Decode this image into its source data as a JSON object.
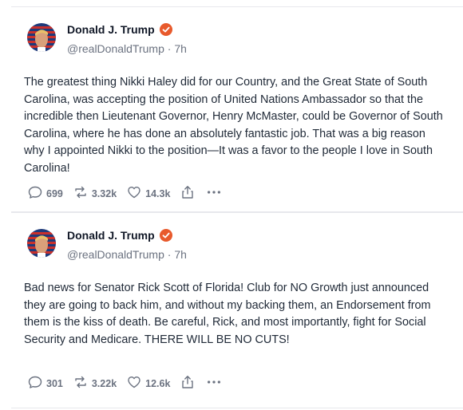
{
  "posts": [
    {
      "author_name": "Donald J. Trump",
      "handle": "@realDonaldTrump",
      "time": "7h",
      "body": "The greatest thing Nikki Haley did for our Country, and the Great State of South Carolina, was accepting the position of United Nations Ambassador so that the incredible then Lieutenant Governor, Henry McMaster, could be Governor of South Carolina, where he has done an absolutely fantastic job. That was a big reason why I appointed Nikki to the position—It was a favor to the people I love in South Carolina!",
      "replies": "699",
      "reposts": "3.32k",
      "likes": "14.3k"
    },
    {
      "author_name": "Donald J. Trump",
      "handle": "@realDonaldTrump",
      "time": "7h",
      "body": "Bad news for Senator Rick Scott of Florida! Club for NO Growth just announced they are going to back him, and without my backing them, an Endorsement from them is the kiss of death. Be careful, Rick, and most importantly, fight for Social Security and Medicare. THERE WILL BE NO CUTS!",
      "replies": "301",
      "reposts": "3.22k",
      "likes": "12.6k"
    }
  ],
  "separator": " · ",
  "colors": {
    "verified": "#e85a2c",
    "muted": "#6b7280",
    "text": "#1f2937"
  }
}
